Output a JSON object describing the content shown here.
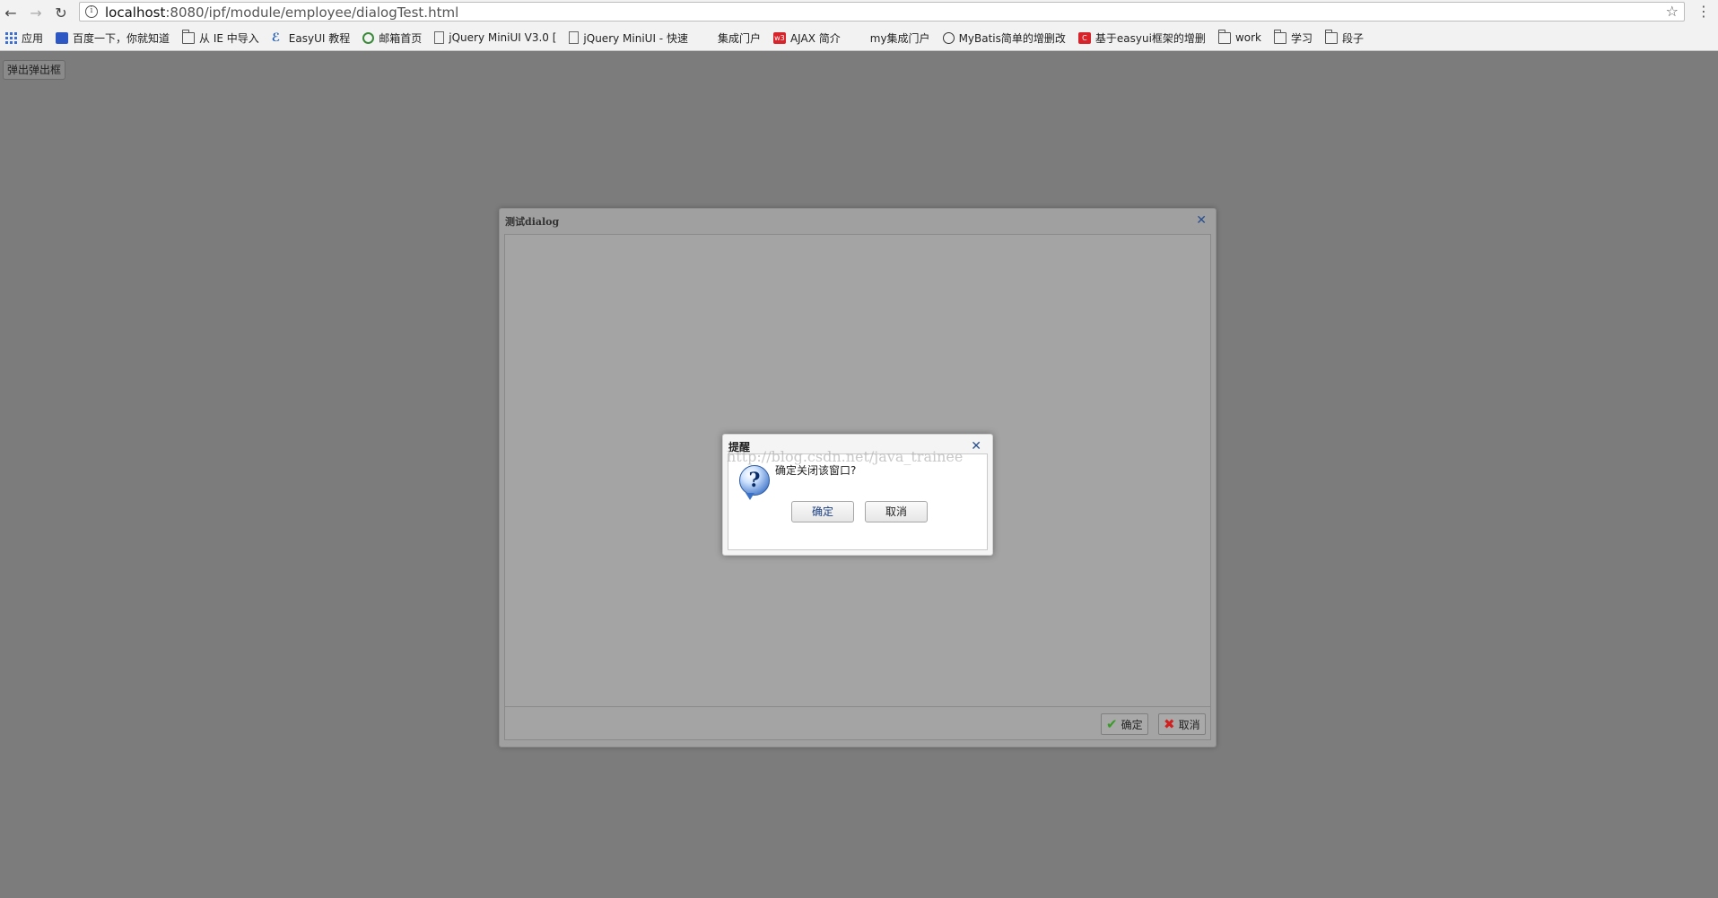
{
  "browser": {
    "url_host": "localhost",
    "url_rest": ":8080/ipf/module/employee/dialogTest.html",
    "bookmarks": [
      {
        "label": "应用",
        "icon": "apps-grid-icon"
      },
      {
        "label": "百度一下，你就知道",
        "icon": "baidu-icon"
      },
      {
        "label": "从 IE 中导入",
        "icon": "folder-icon"
      },
      {
        "label": "EasyUI 教程",
        "icon": "easyui-icon"
      },
      {
        "label": "邮箱首页",
        "icon": "chrome-circle-icon"
      },
      {
        "label": "jQuery MiniUI V3.0 [",
        "icon": "page-icon"
      },
      {
        "label": "jQuery MiniUI - 快速",
        "icon": "page-icon"
      },
      {
        "label": "集成门户",
        "icon": "blank-icon"
      },
      {
        "label": "AJAX 简介",
        "icon": "w3-icon"
      },
      {
        "label": "my集成门户",
        "icon": "blank-icon"
      },
      {
        "label": "MyBatis简单的增删改",
        "icon": "github-cat-icon"
      },
      {
        "label": "基于easyui框架的增删",
        "icon": "csdn-icon"
      },
      {
        "label": "work",
        "icon": "folder-icon"
      },
      {
        "label": "学习",
        "icon": "folder-icon"
      },
      {
        "label": "段子",
        "icon": "folder-icon"
      }
    ]
  },
  "page": {
    "open_button_label": "弹出弹出框"
  },
  "dialog": {
    "title": "测试dialog",
    "confirm_label": "确定",
    "cancel_label": "取消"
  },
  "messager": {
    "title": "提醒",
    "message": "确定关闭该窗口?",
    "ok_label": "确定",
    "cancel_label": "取消",
    "watermark": "http://blog.csdn.net/java_trainee"
  }
}
